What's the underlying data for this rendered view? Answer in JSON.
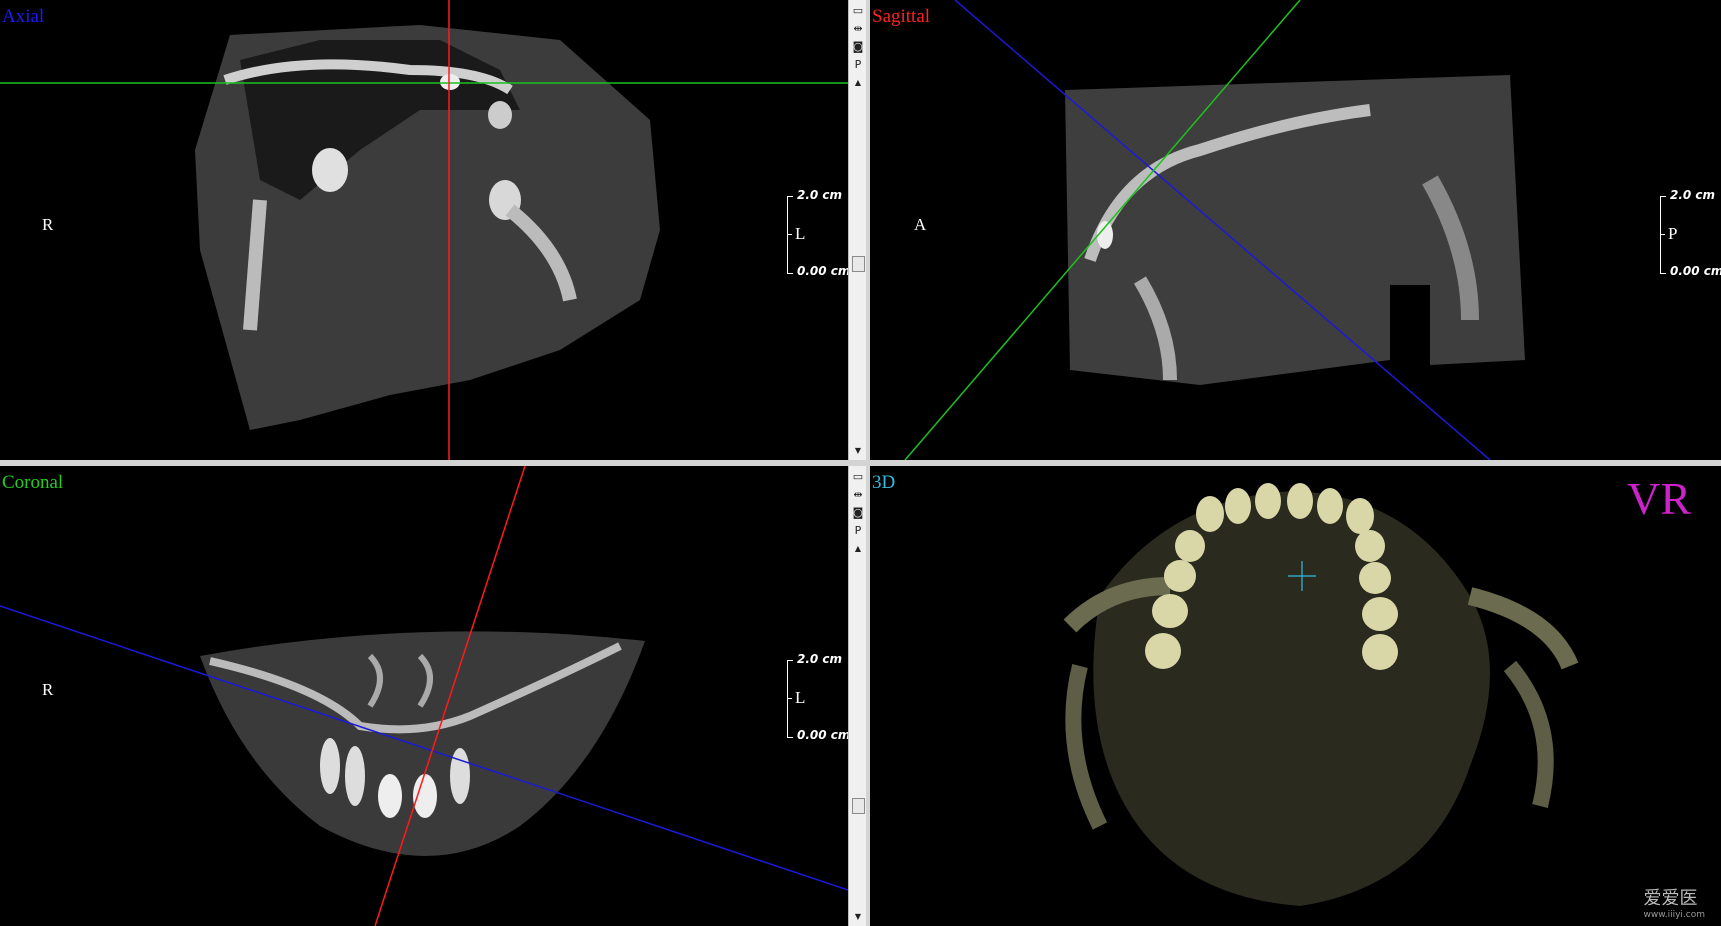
{
  "panes": {
    "axial": {
      "title": "Axial",
      "title_color": "#1a1aff",
      "left_label": "R",
      "scale_mid": "L",
      "scale_top": "2.0 cm",
      "scale_bot": "0.00 cm"
    },
    "sagittal": {
      "title": "Sagittal",
      "title_color": "#ff2020",
      "left_label": "A",
      "scale_mid": "P",
      "scale_top": "2.0 cm",
      "scale_bot": "0.00 cm"
    },
    "coronal": {
      "title": "Coronal",
      "title_color": "#22cc22",
      "left_label": "R",
      "scale_mid": "L",
      "scale_top": "2.0 cm",
      "scale_bot": "0.00 cm"
    },
    "threed": {
      "title": "3D",
      "title_color": "#33bbdd",
      "mode_label": "VR",
      "mode_color": "#cc22cc"
    }
  },
  "scrollbar": {
    "button_p": "P"
  },
  "watermark": {
    "text": "爱爱医",
    "url": "www.iiiyi.com"
  },
  "icons": [
    "restore-icon",
    "split-icon",
    "camera-icon",
    "up-arrow-icon",
    "down-arrow-icon"
  ]
}
